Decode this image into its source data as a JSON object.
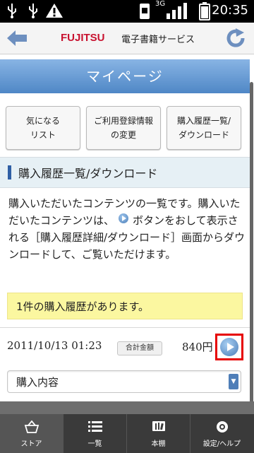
{
  "status_bar": {
    "icons": [
      "usb-icon",
      "usb-icon",
      "warning-icon",
      "sim-icon",
      "signal-3g-icon",
      "battery-icon"
    ],
    "network_label": "3G",
    "time": "20:35"
  },
  "header": {
    "brand": "FUJITSU",
    "service_name": "電子書籍サービス",
    "back_icon": "arrow-left-icon",
    "reload_icon": "reload-icon"
  },
  "page": {
    "title": "マイページ",
    "nav_buttons": [
      {
        "label": "気になる\nリスト"
      },
      {
        "label": "ご利用登録情報\nの変更"
      },
      {
        "label": "購入履歴一覧/\nダウンロード"
      }
    ],
    "section_title": "購入履歴一覧/ダウンロード",
    "description_part1": "購入いただいたコンテンツの一覧です。購入いただいたコンテンツは、",
    "description_part2": "ボタンをおして表示される［購入履歴詳細/ダウンロード］画面からダウンロードして、ご覧いただけます。",
    "notice": "1件の購入履歴があります。"
  },
  "order": {
    "datetime": "2011/10/13 01:23",
    "total_label": "合計金額",
    "total_amount": "840円",
    "play_icon": "play-circle-icon"
  },
  "details_select": {
    "selected": "購入内容"
  },
  "bottom_nav": [
    {
      "label": "ストア",
      "icon": "basket-icon"
    },
    {
      "label": "一覧",
      "icon": "list-icon"
    },
    {
      "label": "本棚",
      "icon": "bookshelf-icon"
    },
    {
      "label": "設定/ヘルプ",
      "icon": "settings-icon"
    }
  ],
  "colors": {
    "title_bar": "#4f87c6",
    "brand_red": "#c8102e",
    "notice_bg": "#fbf7a0",
    "highlight_border": "#e60000",
    "bottom_nav_bg": "#3a3a3a"
  }
}
